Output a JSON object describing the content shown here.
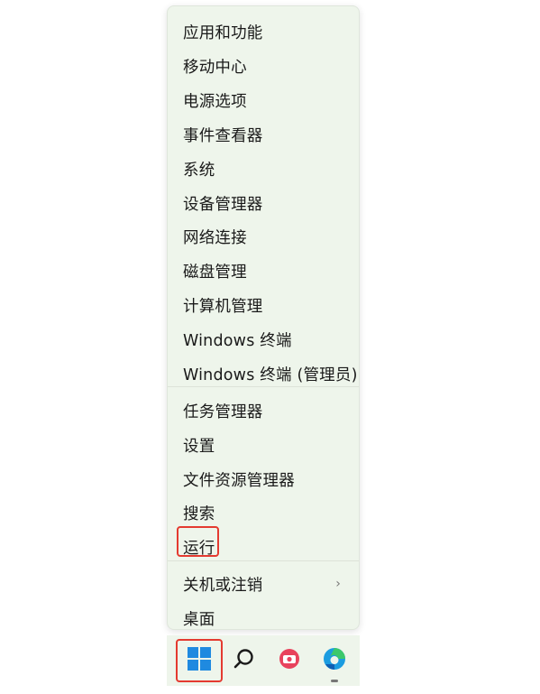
{
  "menu": {
    "items": [
      {
        "label": "应用和功能"
      },
      {
        "label": "移动中心"
      },
      {
        "label": "电源选项"
      },
      {
        "label": "事件查看器"
      },
      {
        "label": "系统"
      },
      {
        "label": "设备管理器"
      },
      {
        "label": "网络连接"
      },
      {
        "label": "磁盘管理"
      },
      {
        "label": "计算机管理"
      },
      {
        "label": "Windows 终端"
      },
      {
        "label": "Windows 终端 (管理员)"
      },
      {
        "label": "任务管理器"
      },
      {
        "label": "设置"
      },
      {
        "label": "文件资源管理器"
      },
      {
        "label": "搜索"
      },
      {
        "label": "运行"
      },
      {
        "label": "关机或注销",
        "submenu_glyph": "›"
      },
      {
        "label": "桌面"
      }
    ]
  },
  "taskbar": {
    "buttons": [
      {
        "icon": "windows-start-icon"
      },
      {
        "icon": "search-icon"
      },
      {
        "icon": "camera-app-icon"
      },
      {
        "icon": "edge-browser-icon"
      }
    ]
  },
  "colors": {
    "menu_bg": "#eef5eb",
    "highlight": "#e43a30",
    "windows_blue": "#1f8ae0"
  }
}
